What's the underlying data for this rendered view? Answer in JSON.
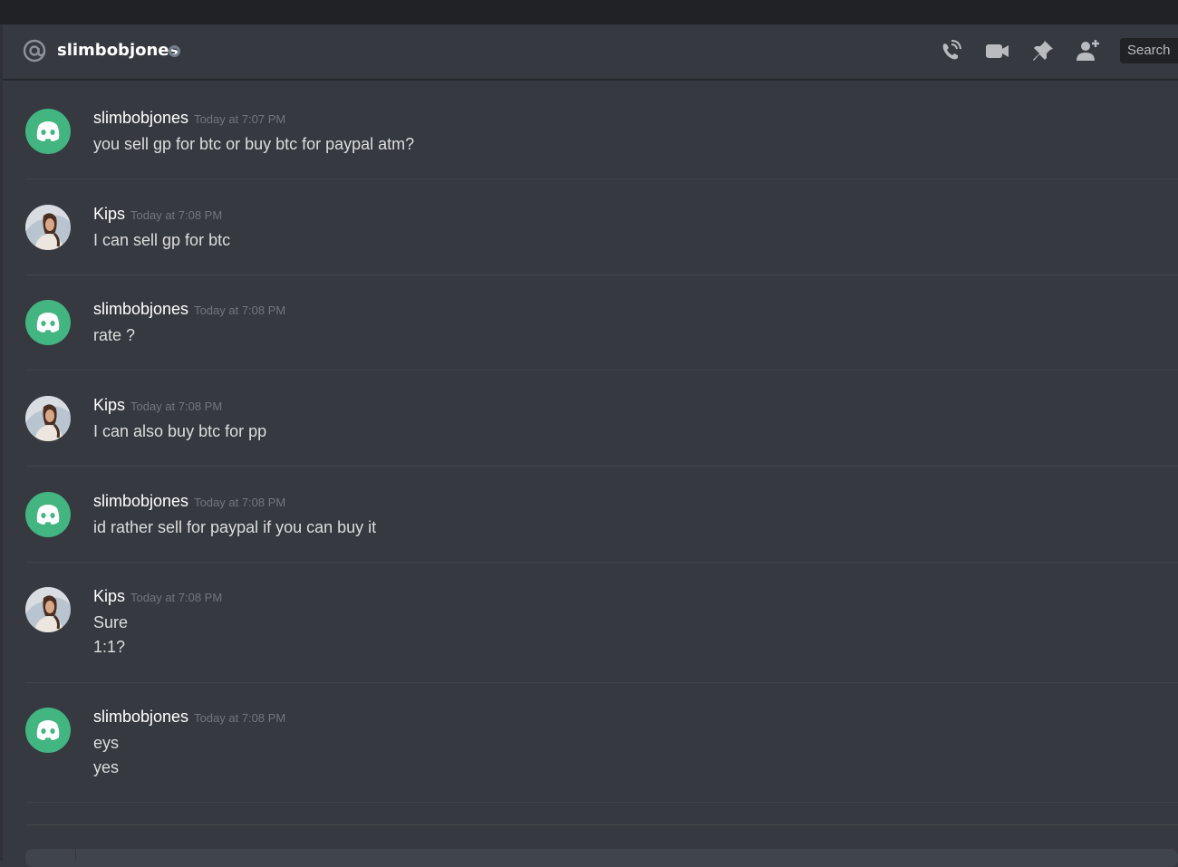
{
  "header": {
    "channel_name": "slimbobjones",
    "icons": [
      "at-icon",
      "status-offline-icon",
      "voice-call-icon",
      "video-call-icon",
      "pinned-icon",
      "add-friend-icon"
    ],
    "search_placeholder": "Search"
  },
  "colors": {
    "background": "#36393f",
    "topbar": "#202225",
    "discord_green": "#43b581",
    "username": "#ffffff",
    "text": "#dcddde",
    "timestamp": "#72767d"
  },
  "messages": [
    {
      "author": "slimbobjones",
      "timestamp": "Today at 7:07 PM",
      "avatar": "discord-default-avatar",
      "lines": [
        "you sell gp for btc or buy btc for paypal atm?"
      ]
    },
    {
      "author": "Kips",
      "timestamp": "Today at 7:08 PM",
      "avatar": "user-photo-avatar",
      "lines": [
        "I can sell gp for btc"
      ]
    },
    {
      "author": "slimbobjones",
      "timestamp": "Today at 7:08 PM",
      "avatar": "discord-default-avatar",
      "lines": [
        "rate ?"
      ]
    },
    {
      "author": "Kips",
      "timestamp": "Today at 7:08 PM",
      "avatar": "user-photo-avatar",
      "lines": [
        "I can also buy btc for pp"
      ]
    },
    {
      "author": "slimbobjones",
      "timestamp": "Today at 7:08 PM",
      "avatar": "discord-default-avatar",
      "lines": [
        "id rather sell for paypal if you can buy it"
      ]
    },
    {
      "author": "Kips",
      "timestamp": "Today at 7:08 PM",
      "avatar": "user-photo-avatar",
      "lines": [
        "Sure",
        "1:1?"
      ]
    },
    {
      "author": "slimbobjones",
      "timestamp": "Today at 7:08 PM",
      "avatar": "discord-default-avatar",
      "lines": [
        "eys",
        "yes"
      ]
    }
  ]
}
